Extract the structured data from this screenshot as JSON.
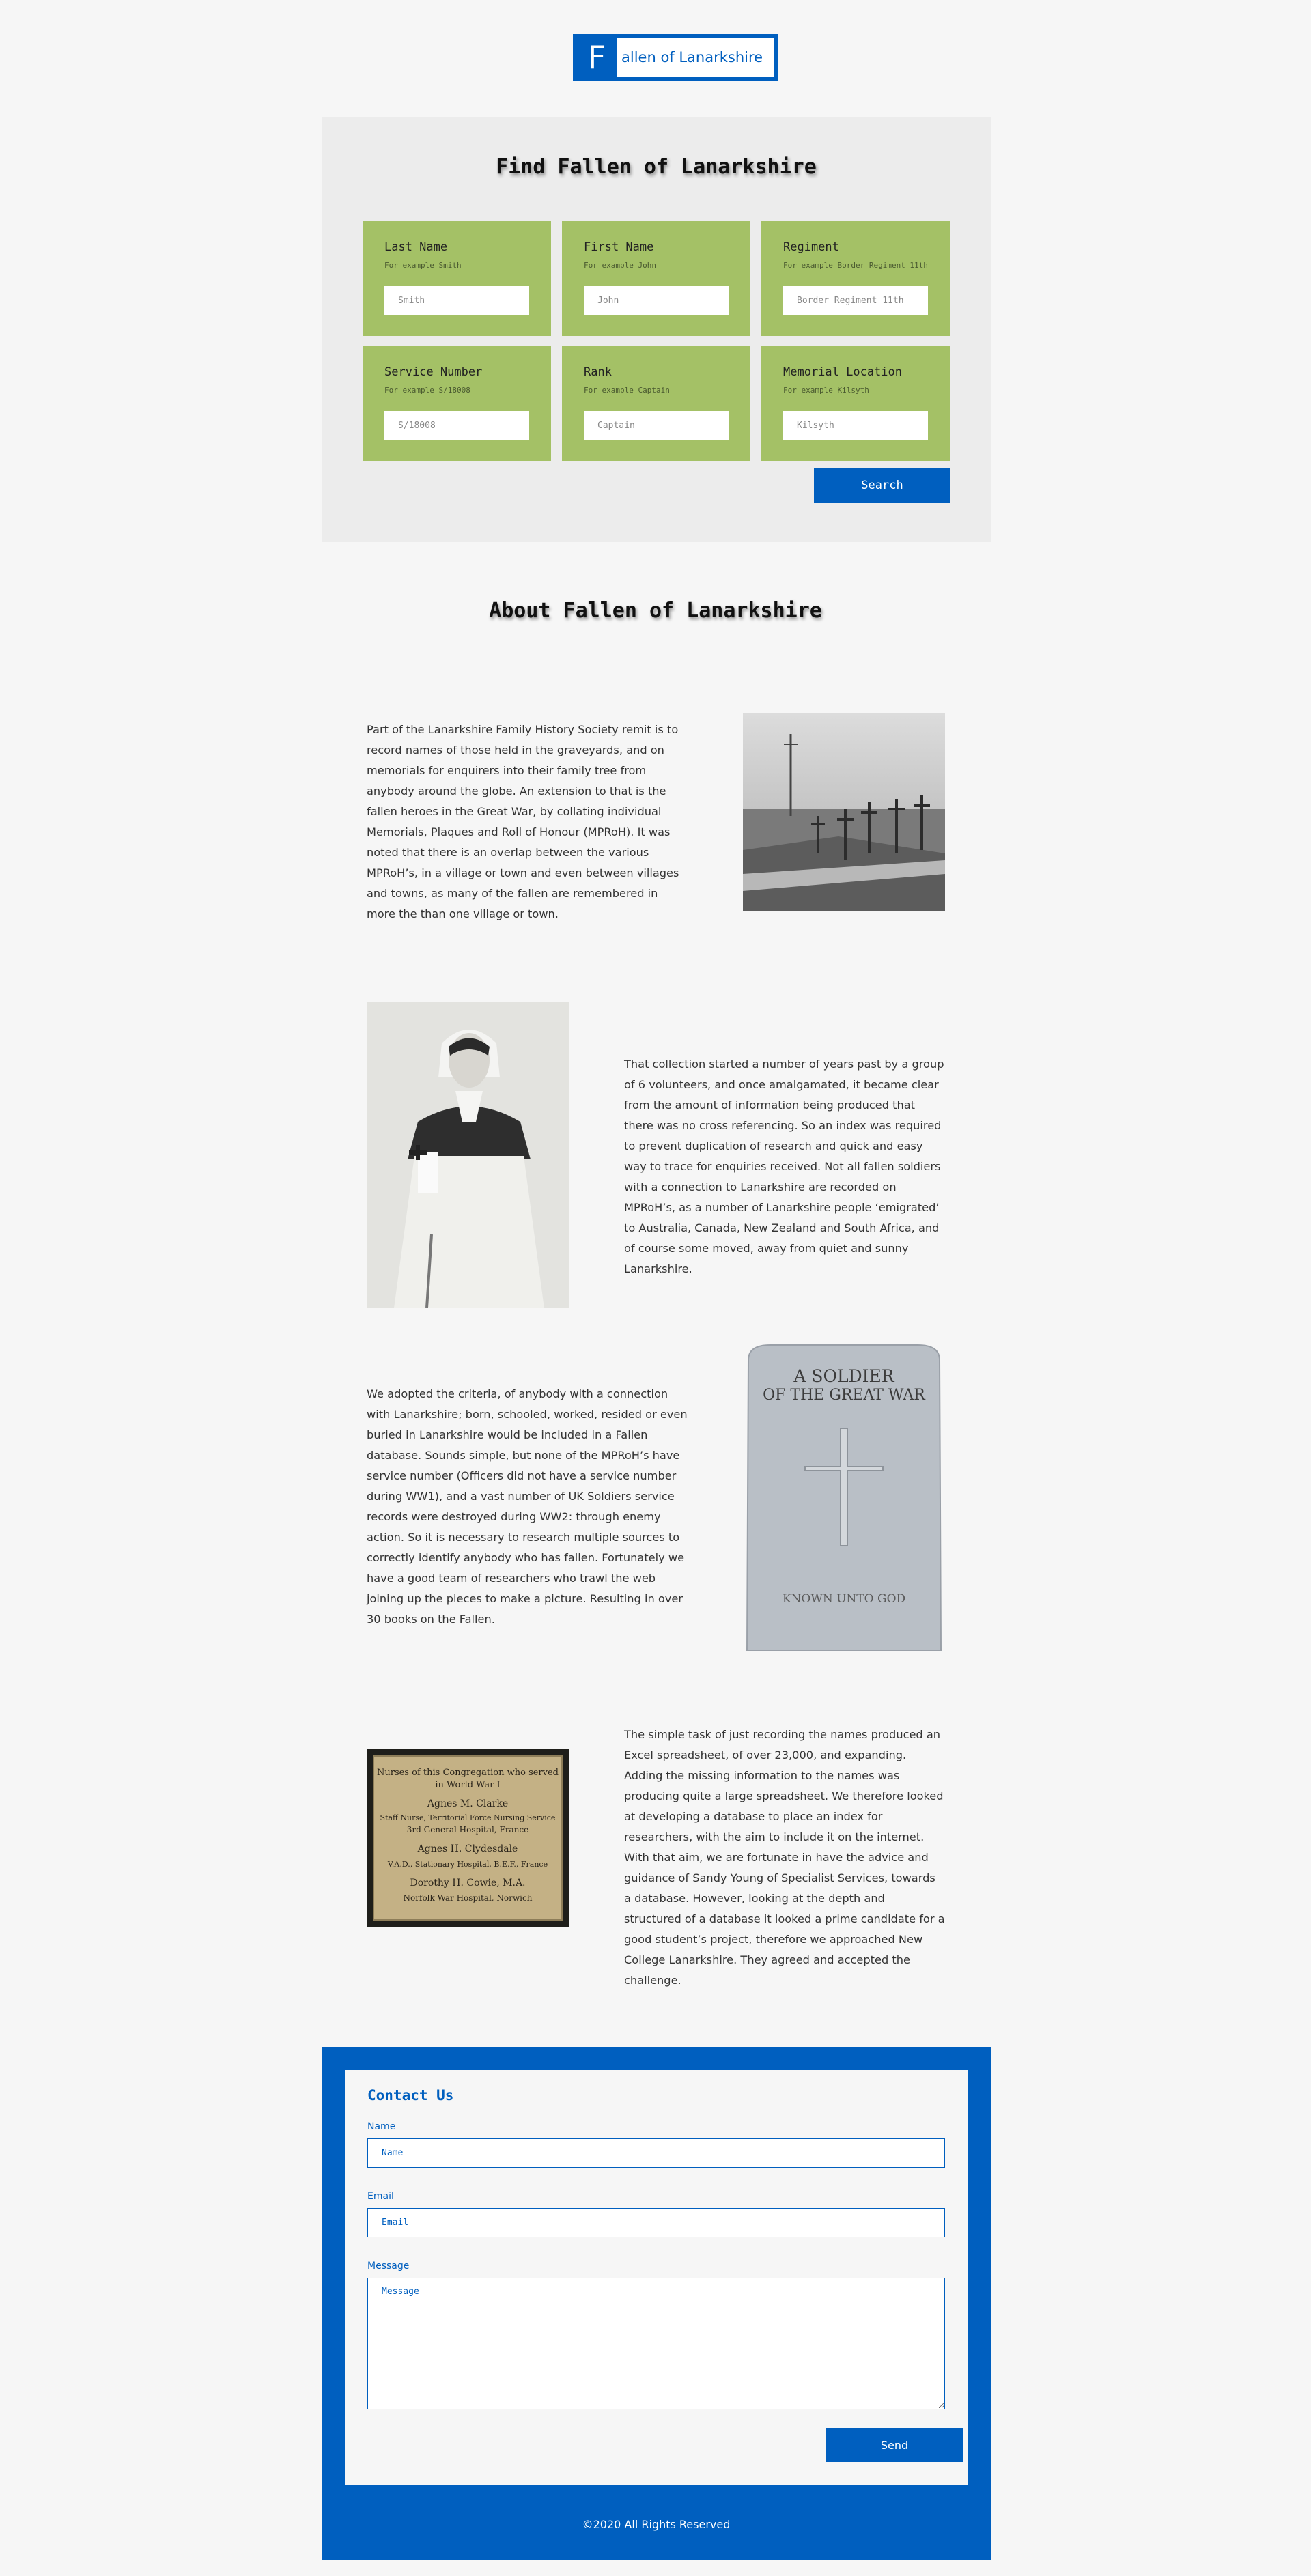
{
  "logo": {
    "letter": "F",
    "text": "allen of Lanarkshire"
  },
  "search": {
    "title": "Find Fallen of Lanarkshire",
    "fields": [
      {
        "label": "Last Name",
        "hint": "For example Smith",
        "placeholder": "Smith"
      },
      {
        "label": "First Name",
        "hint": "For example John",
        "placeholder": "John"
      },
      {
        "label": "Regiment",
        "hint": "For example Border Regiment 11th",
        "placeholder": "Border Regiment 11th"
      },
      {
        "label": "Service Number",
        "hint": "For example S/18008",
        "placeholder": "S/18008"
      },
      {
        "label": "Rank",
        "hint": "For example Captain",
        "placeholder": "Captain"
      },
      {
        "label": "Memorial Location",
        "hint": "For example Kilsyth",
        "placeholder": "Kilsyth"
      }
    ],
    "button_label": "Search"
  },
  "about": {
    "title": "About Fallen of Lanarkshire",
    "paragraphs": [
      "Part of the Lanarkshire Family History Society remit is to record names of those held in the graveyards, and on memorials for enquirers into their family tree from anybody around the globe. An extension to that is the fallen heroes in the Great War, by collating individual Memorials, Plaques and Roll of Honour (MPRoH). It was noted that there is an overlap between the various MPRoH’s, in a village or town and even between villages and towns, as many of the fallen are remembered in more the than one village or town.",
      "That collection started a number of years past by a group of 6 volunteers, and once amalgamated, it became clear from the amount of information being produced that there was no cross referencing. So an index was required to prevent duplication of research and quick and easy way to trace for enquiries received. Not all fallen soldiers with a connection to Lanarkshire are recorded on MPRoH’s, as a number of Lanarkshire people ‘emigrated’ to Australia, Canada, New Zealand and South Africa, and of course some moved, away from quiet and sunny Lanarkshire.",
      "We adopted the criteria, of anybody with a connection with Lanarkshire; born, schooled, worked, resided or even buried in Lanarkshire would be included in a Fallen database. Sounds simple, but none of the MPRoH’s have service number (Officers did not have a service number during WW1), and a vast number of UK Soldiers service records were destroyed during WW2: through enemy action. So it is necessary to research multiple sources to correctly identify anybody who has fallen. Fortunately we have a good team of researchers who trawl the web joining up the pieces to make a picture. Resulting in over 30 books on the Fallen.",
      "The simple task of just recording the names produced an Excel spreadsheet, of over 23,000, and expanding. Adding the missing information to the names was producing quite a large spreadsheet. We therefore looked at developing a database to place an index for researchers, with the aim to include it on the internet. With that aim, we are fortunate in have the advice and guidance of Sandy Young of Specialist Services, towards a database. However, looking at the depth and structured of a database it looked a prime candidate for a good student’s project, therefore we approached New College Lanarkshire. They agreed and accepted the challenge."
    ],
    "headstone": {
      "line1": "A SOLDIER",
      "line2": "OF THE GREAT WAR",
      "line3": "KNOWN UNTO GOD"
    },
    "plaque": {
      "lines": [
        "Nurses of this Congregation who served",
        "in World War I",
        "Agnes M. Clarke",
        "Staff Nurse, Territorial Force Nursing Service",
        "3rd General Hospital, France",
        "Agnes H. Clydesdale",
        "V.A.D., Stationary Hospital, B.E.F., France",
        "Dorothy H. Cowie, M.A.",
        "Norfolk War Hospital, Norwich"
      ]
    }
  },
  "contact": {
    "title": "Contact Us",
    "name_label": "Name",
    "name_placeholder": "Name",
    "email_label": "Email",
    "email_placeholder": "Email",
    "message_label": "Message",
    "message_placeholder": "Message",
    "send_label": "Send"
  },
  "footer": {
    "copyright": "©2020 All Rights Reserved"
  },
  "colors": {
    "brand_blue": "#005fbf",
    "field_green": "#a4c166",
    "panel_grey": "#ececec"
  }
}
